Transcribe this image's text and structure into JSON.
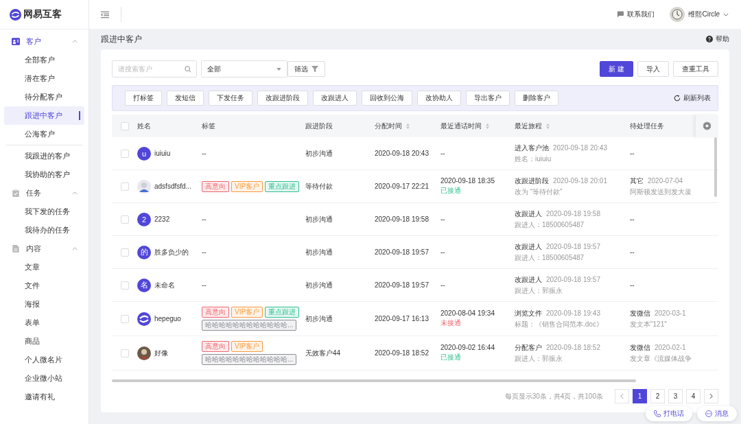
{
  "brand": {
    "name": "网易互客"
  },
  "sidebar": {
    "groups": [
      {
        "label": "客户",
        "selected": true,
        "expanded": true,
        "items": [
          {
            "label": "全部客户",
            "selected": false,
            "divider_before": false
          },
          {
            "label": "潜在客户",
            "selected": false,
            "divider_before": false
          },
          {
            "label": "待分配客户",
            "selected": false,
            "divider_before": false
          },
          {
            "label": "跟进中客户",
            "selected": true,
            "divider_before": false
          },
          {
            "label": "公海客户",
            "selected": false,
            "divider_before": false
          },
          {
            "label": "我跟进的客户",
            "selected": false,
            "divider_before": true
          },
          {
            "label": "我协助的客户",
            "selected": false,
            "divider_before": false
          }
        ]
      },
      {
        "label": "任务",
        "selected": false,
        "expanded": true,
        "items": [
          {
            "label": "我下发的任务",
            "selected": false,
            "divider_before": false
          },
          {
            "label": "我待办的任务",
            "selected": false,
            "divider_before": false
          }
        ]
      },
      {
        "label": "内容",
        "selected": false,
        "expanded": true,
        "items": [
          {
            "label": "文章",
            "selected": false,
            "divider_before": false
          },
          {
            "label": "文件",
            "selected": false,
            "divider_before": false
          },
          {
            "label": "海报",
            "selected": false,
            "divider_before": false
          },
          {
            "label": "表单",
            "selected": false,
            "divider_before": false
          },
          {
            "label": "商品",
            "selected": false,
            "divider_before": false
          },
          {
            "label": "个人微名片",
            "selected": false,
            "divider_before": false
          },
          {
            "label": "企业微小站",
            "selected": false,
            "divider_before": false
          },
          {
            "label": "邀请有礼",
            "selected": false,
            "divider_before": false
          }
        ]
      }
    ]
  },
  "header": {
    "contact": "联系我们",
    "user": "维熙Circle"
  },
  "page": {
    "title": "跟进中客户",
    "help": "帮助"
  },
  "filters": {
    "search_placeholder": "请搜索客户",
    "select_value": "全部",
    "filter_button": "筛选"
  },
  "actions": [
    "新 建",
    "导入",
    "查重工具"
  ],
  "toolbar": {
    "buttons": [
      "打标签",
      "发短信",
      "下发任务",
      "改跟进阶段",
      "改跟进人",
      "回收到公海",
      "改协助人",
      "导出客户",
      "删除客户"
    ],
    "refresh": "刷新列表"
  },
  "table": {
    "all_checked": false,
    "columns": [
      {
        "label": "姓名",
        "sortable": false
      },
      {
        "label": "标签",
        "sortable": false
      },
      {
        "label": "跟进阶段",
        "sortable": false
      },
      {
        "label": "分配时间",
        "sortable": true
      },
      {
        "label": "最近通话时间",
        "sortable": true
      },
      {
        "label": "最近旅程",
        "sortable": true
      },
      {
        "label": "待处理任务",
        "sortable": false
      }
    ],
    "rows": [
      {
        "checked": false,
        "avatar": {
          "kind": "letter",
          "text": "u"
        },
        "name": "iuiuiu",
        "tags": [],
        "empty_tags": "--",
        "stage": "初步沟通",
        "assigned": "2020-09-18 20:43",
        "call": {
          "empty": "--"
        },
        "journey": {
          "title": "进入客户池",
          "time": "2020-09-18 20:43",
          "detail": "姓名：iuiuiu"
        },
        "task": {
          "empty": "--"
        }
      },
      {
        "checked": false,
        "avatar": {
          "kind": "picture"
        },
        "name": "adsfsdfsfd...",
        "tags": [
          {
            "label": "高意向",
            "color": "#f0636b"
          },
          {
            "label": "VIP客户",
            "color": "#f79a3e"
          },
          {
            "label": "重点跟进",
            "color": "#2fbf8f"
          }
        ],
        "stage": "等待付款",
        "assigned": "2020-09-17 22:21",
        "call": {
          "time": "2020-09-18 18:35",
          "status": "已接通",
          "connected": true
        },
        "journey": {
          "title": "改跟进阶段",
          "time": "2020-09-18 20:01",
          "detail": "改为 “等待付款”"
        },
        "task": {
          "title": "其它",
          "time": "2020-07-04",
          "detail": "阿斯顿发送到发大厦"
        }
      },
      {
        "checked": false,
        "avatar": {
          "kind": "letter",
          "text": "2"
        },
        "name": "2232",
        "tags": [],
        "empty_tags": "--",
        "stage": "初步沟通",
        "assigned": "2020-09-18 19:58",
        "call": {
          "empty": "--"
        },
        "journey": {
          "title": "改跟进人",
          "time": "2020-09-18 19:58",
          "detail": "跟进人：18500605487"
        },
        "task": {
          "empty": "--"
        }
      },
      {
        "checked": false,
        "avatar": {
          "kind": "letter",
          "text": "的"
        },
        "name": "胜多负少的",
        "tags": [],
        "empty_tags": "--",
        "stage": "初步沟通",
        "assigned": "2020-09-18 19:57",
        "call": {
          "empty": "--"
        },
        "journey": {
          "title": "改跟进人",
          "time": "2020-09-18 19:57",
          "detail": "跟进人：18500605487"
        },
        "task": {
          "empty": "--"
        }
      },
      {
        "checked": false,
        "avatar": {
          "kind": "letter",
          "text": "名"
        },
        "name": "未命名",
        "tags": [],
        "empty_tags": "--",
        "stage": "初步沟通",
        "assigned": "2020-09-18 19:57",
        "call": {
          "empty": "--"
        },
        "journey": {
          "title": "改跟进人",
          "time": "2020-09-18 19:57",
          "detail": "跟进人：郭振永"
        },
        "task": {
          "empty": "--"
        }
      },
      {
        "checked": false,
        "avatar": {
          "kind": "logo"
        },
        "name": "hepeguo",
        "tags": [
          {
            "label": "高意向",
            "color": "#f0636b"
          },
          {
            "label": "VIP客户",
            "color": "#f79a3e"
          },
          {
            "label": "重点跟进",
            "color": "#2fbf8f"
          },
          {
            "label": "哈哈哈哈哈哈哈哈哈哈哈哈...",
            "color": "#8a8d96"
          }
        ],
        "stage": "初步沟通",
        "assigned": "2020-09-17 16:13",
        "call": {
          "time": "2020-08-04 19:34",
          "status": "未接通",
          "connected": false
        },
        "journey": {
          "title": "浏览文件",
          "time": "2020-09-18 19:43",
          "detail": "标题：《销售合同范本.doc》"
        },
        "task": {
          "title": "发微信",
          "time": "2020-03-1",
          "detail": "发文本\"121\""
        }
      },
      {
        "checked": false,
        "avatar": {
          "kind": "picture"
        },
        "name": "好像",
        "tags": [
          {
            "label": "高意向",
            "color": "#f0636b"
          },
          {
            "label": "VIP客户",
            "color": "#f79a3e"
          },
          {
            "label": "哈哈哈哈哈哈哈哈哈哈哈哈...",
            "color": "#8a8d96"
          }
        ],
        "stage": "无效客户44",
        "assigned": "2020-09-18 18:52",
        "call": {
          "time": "2020-09-02 16:44",
          "status": "已接通",
          "connected": true
        },
        "journey": {
          "title": "分配客户",
          "time": "2020-09-18 18:52",
          "detail": "跟进人：郭振永"
        },
        "task": {
          "title": "发微信",
          "time": "2020-02-1",
          "detail": "发文章《流媒体战争"
        }
      }
    ]
  },
  "pagination": {
    "summary": "每页显示30条，共4页，共100条",
    "pages": [
      {
        "label": "1",
        "selected": true
      },
      {
        "label": "2",
        "selected": false
      },
      {
        "label": "3",
        "selected": false
      },
      {
        "label": "4",
        "selected": false
      }
    ]
  },
  "floating": {
    "call": "打电话",
    "message": "消息"
  }
}
